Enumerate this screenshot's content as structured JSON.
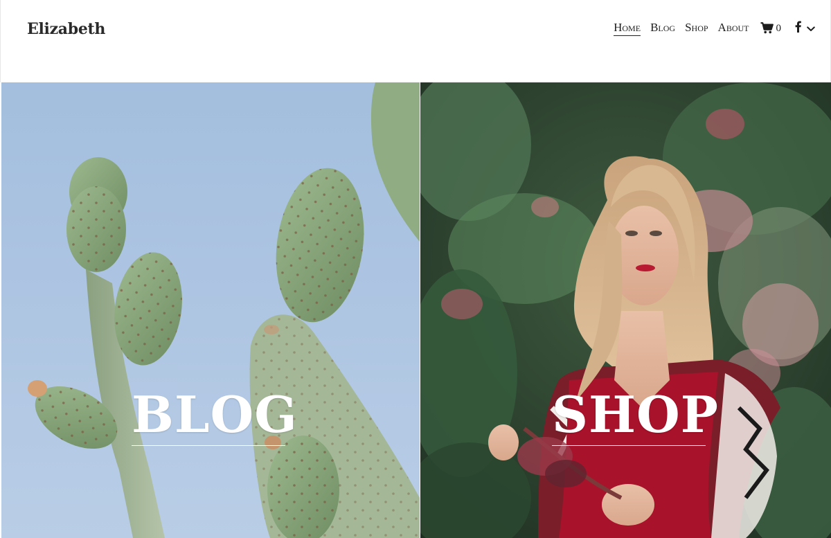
{
  "brand": "Elizabeth",
  "nav": {
    "items": [
      {
        "label": "Home",
        "active": true
      },
      {
        "label": "Blog",
        "active": false
      },
      {
        "label": "Shop",
        "active": false
      },
      {
        "label": "About",
        "active": false
      }
    ],
    "cart_count": "0",
    "cart_icon": "shopping-cart-icon",
    "social_icon": "facebook-icon",
    "dropdown_icon": "chevron-down-icon"
  },
  "panels": {
    "blog": {
      "title": "BLOG"
    },
    "shop": {
      "title": "SHOP"
    }
  },
  "colors": {
    "sky": "#a9c3e0",
    "cactus": "#8fae85",
    "foliage": "#2f4a35",
    "dress": "#a8122b",
    "text_on_image": "#ffffff"
  }
}
